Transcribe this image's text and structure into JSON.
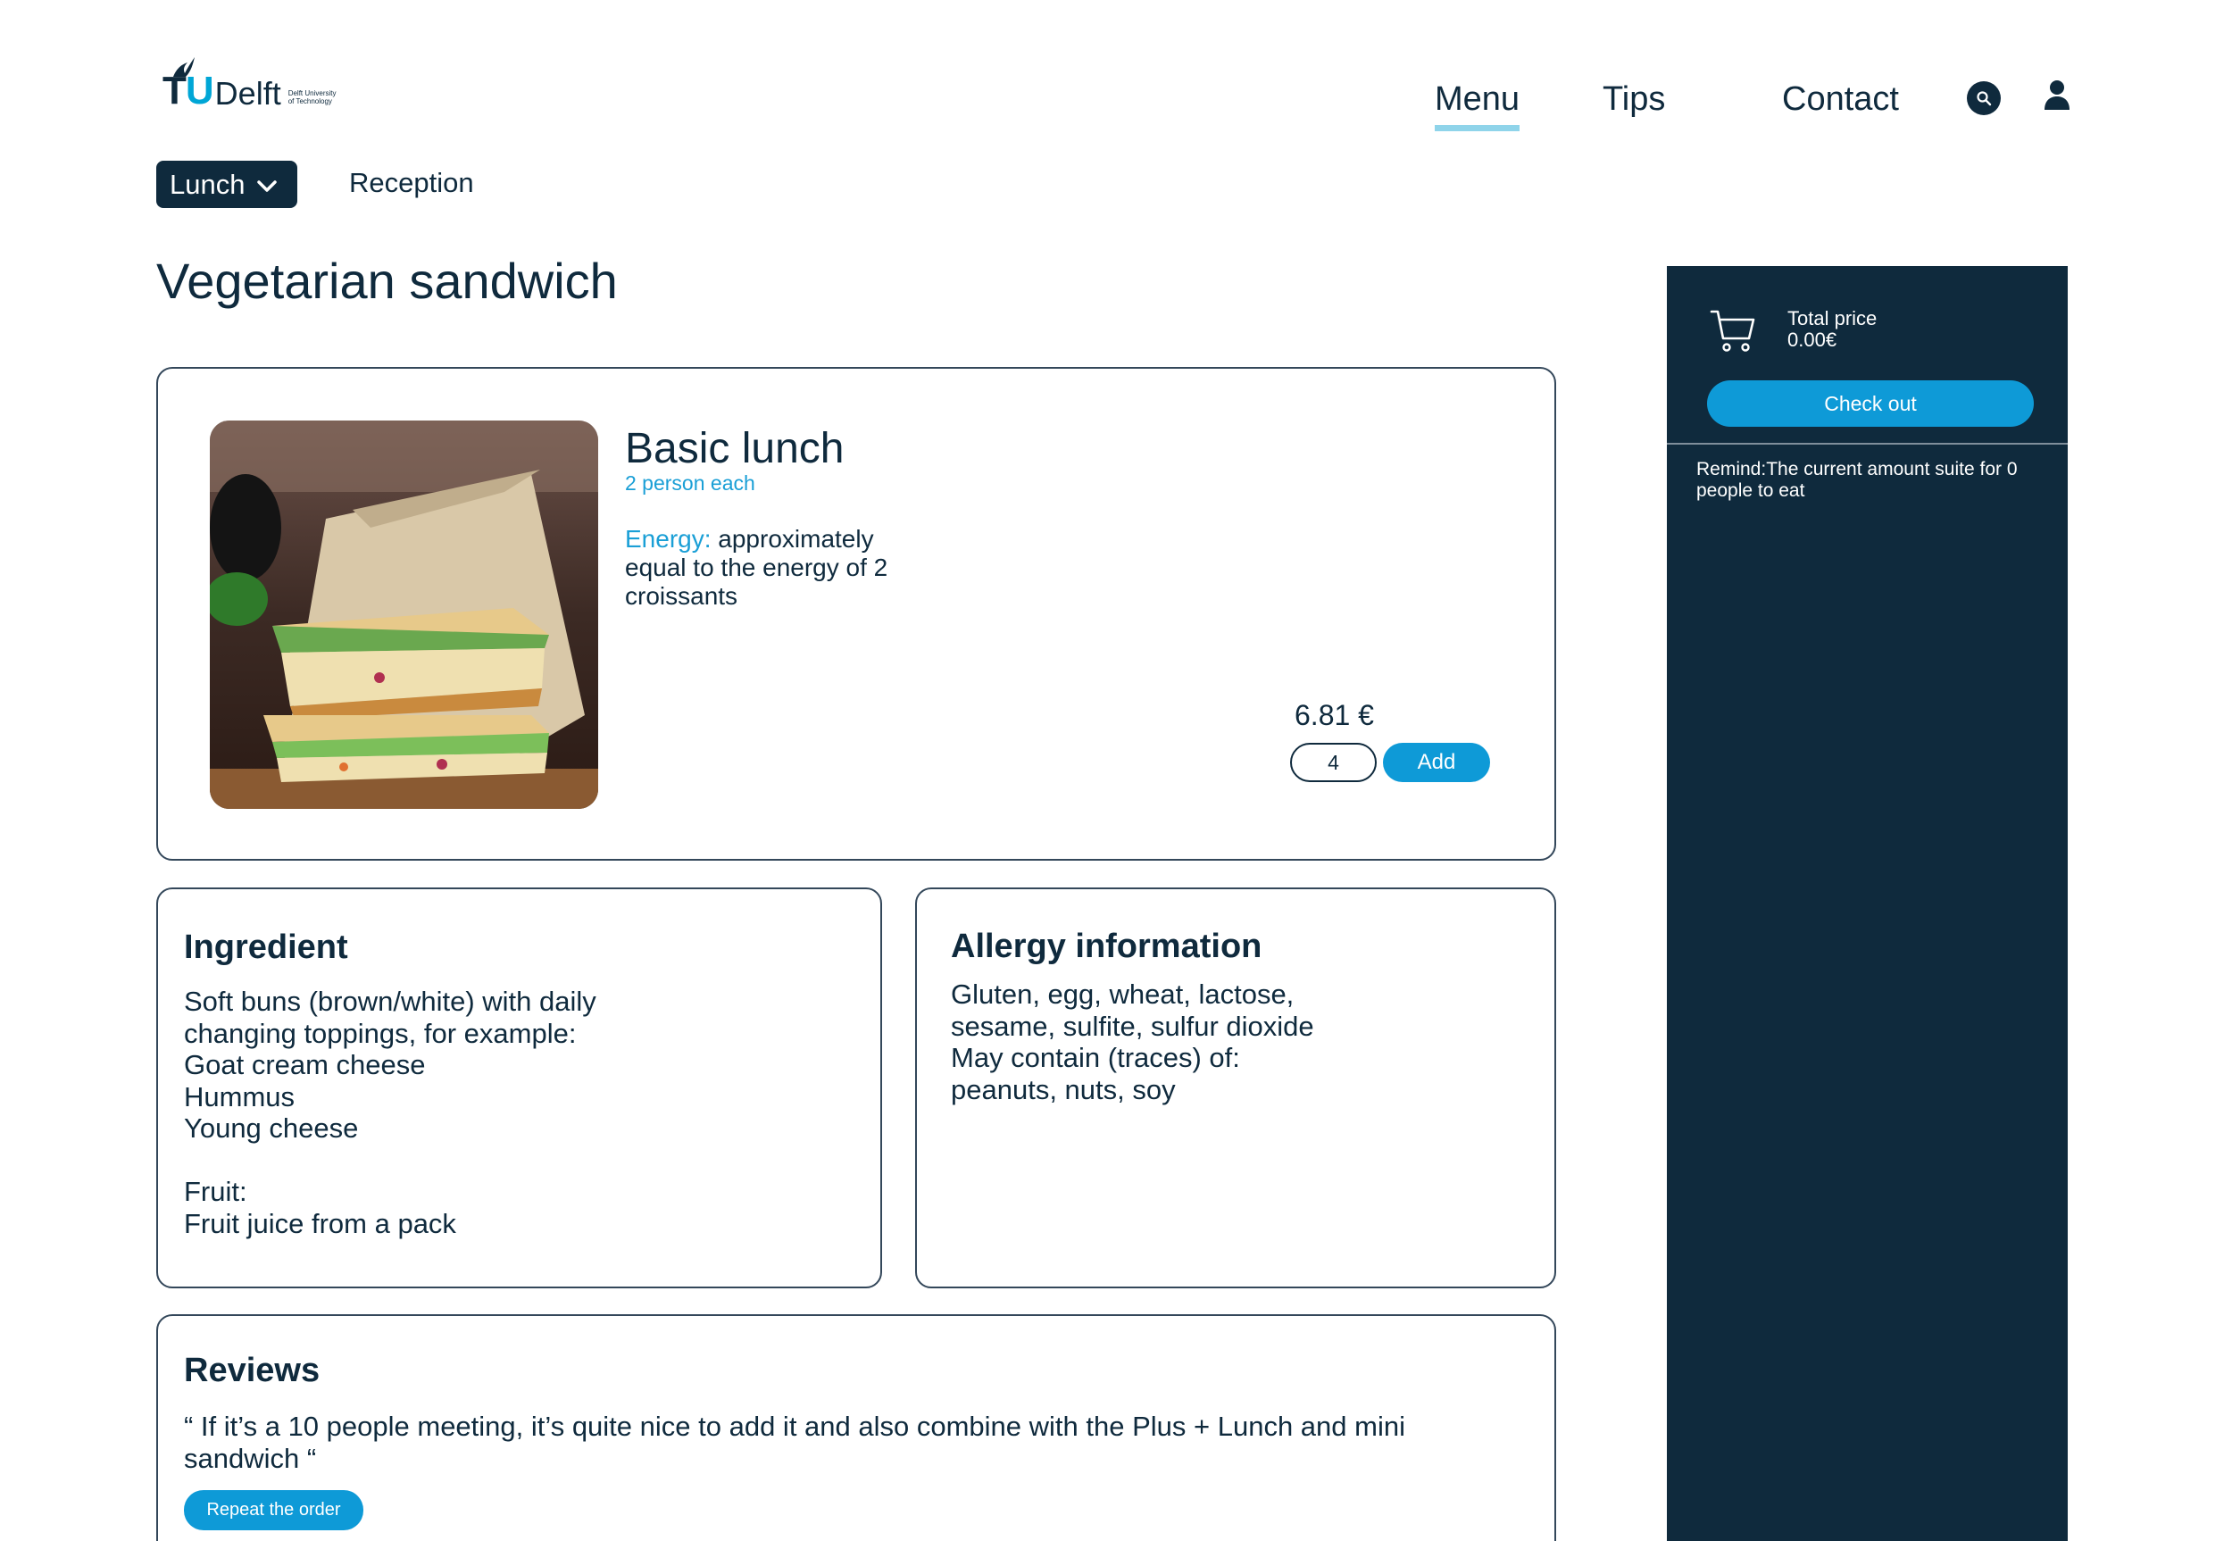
{
  "header": {
    "logo": {
      "tu": "TU",
      "delft": "Delft",
      "subtitle": "Delft University of Technology"
    },
    "nav": [
      {
        "label": "Menu",
        "active": true
      },
      {
        "label": "Tips"
      },
      {
        "label": "Contact"
      }
    ],
    "icons": {
      "search": "search-icon",
      "user": "user-icon"
    }
  },
  "categories": {
    "active": "Lunch",
    "other": "Reception"
  },
  "page_title": "Vegetarian sandwich",
  "product": {
    "name": "Basic lunch",
    "persons": "2 person each",
    "energy_label": "Energy:",
    "energy_text": " approximately equal to the energy of 2 croissants",
    "price": "6.81 €",
    "quantity": "4",
    "add_label": "Add"
  },
  "ingredient": {
    "title": "Ingredient",
    "text": "Soft buns (brown/white) with daily changing toppings, for example:\nGoat cream cheese\nHummus\nYoung cheese\n\nFruit:\nFruit juice from a pack"
  },
  "allergy": {
    "title": "Allergy information",
    "text": "Gluten, egg, wheat, lactose,\nsesame, sulfite, sulfur dioxide\nMay contain (traces) of:\npeanuts, nuts, soy"
  },
  "reviews": {
    "title": "Reviews",
    "quote": "“ If it’s a 10 people meeting, it’s quite nice to add it and also combine with the Plus + Lunch  and mini sandwich “",
    "repeat_label": "Repeat the order"
  },
  "cart": {
    "total_label": "Total price",
    "total_value": "0.00€",
    "checkout_label": "Check out",
    "remind": "Remind:The current amount suite for 0 people to eat"
  },
  "colors": {
    "navy": "#0f2a3d",
    "accent": "#0e9ad7",
    "highlight": "#8fd4ea"
  }
}
